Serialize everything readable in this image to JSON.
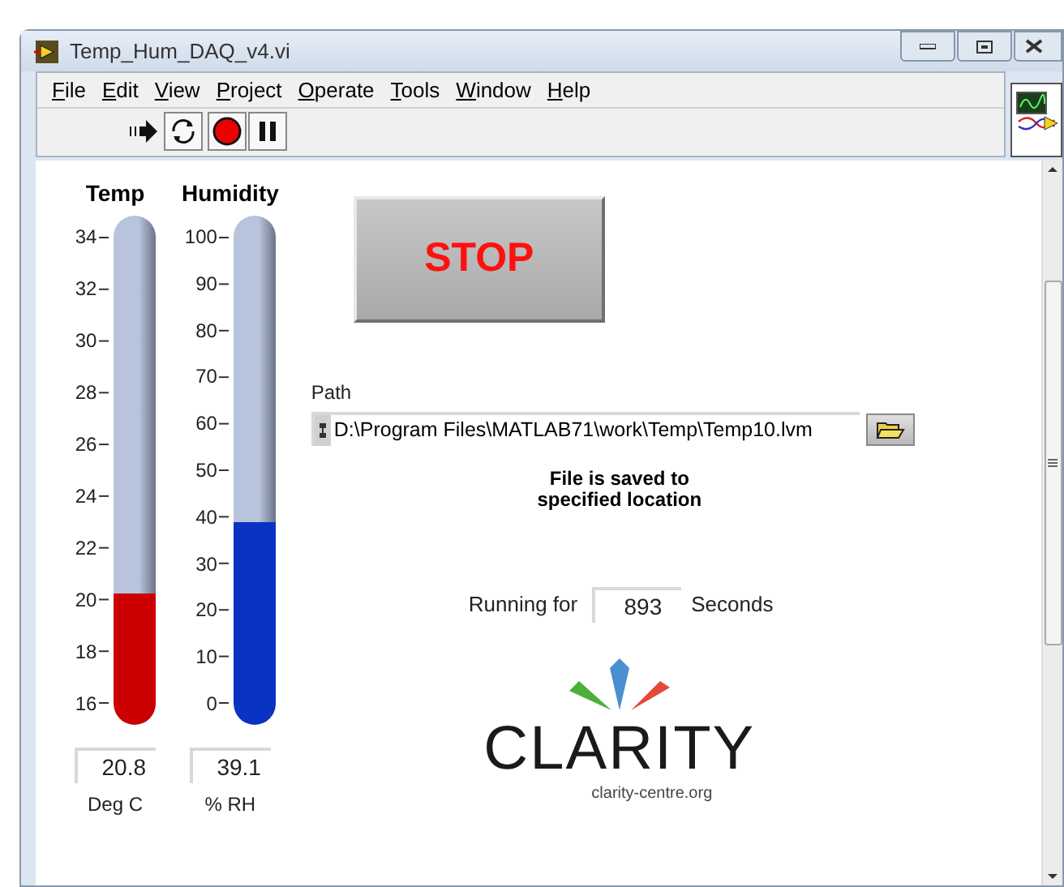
{
  "window": {
    "title": "Temp_Hum_DAQ_v4.vi"
  },
  "menu": [
    "File",
    "Edit",
    "View",
    "Project",
    "Operate",
    "Tools",
    "Window",
    "Help"
  ],
  "gauges": [
    {
      "title": "Temp",
      "ticks": [
        "34",
        "32",
        "30",
        "28",
        "26",
        "24",
        "22",
        "20",
        "18",
        "16"
      ],
      "level": 0.235,
      "color": "#cc0000",
      "value": "20.8",
      "unit": "Deg C"
    },
    {
      "title": "Humidity",
      "ticks": [
        "100",
        "90",
        "80",
        "70",
        "60",
        "50",
        "40",
        "30",
        "20",
        "10",
        "0"
      ],
      "level": 0.39,
      "color": "#0a33c4",
      "value": "39.1",
      "unit": "% RH"
    }
  ],
  "stop_button": {
    "label": "STOP"
  },
  "path": {
    "label": "Path",
    "value": "D:\\Program Files\\MATLAB71\\work\\Temp\\Temp10.lvm"
  },
  "message": "File is saved to specified location",
  "running": {
    "label": "Running for",
    "value": "893",
    "unit": "Seconds"
  },
  "logo": {
    "name": "CLARITY",
    "url": "clarity-centre.org"
  }
}
